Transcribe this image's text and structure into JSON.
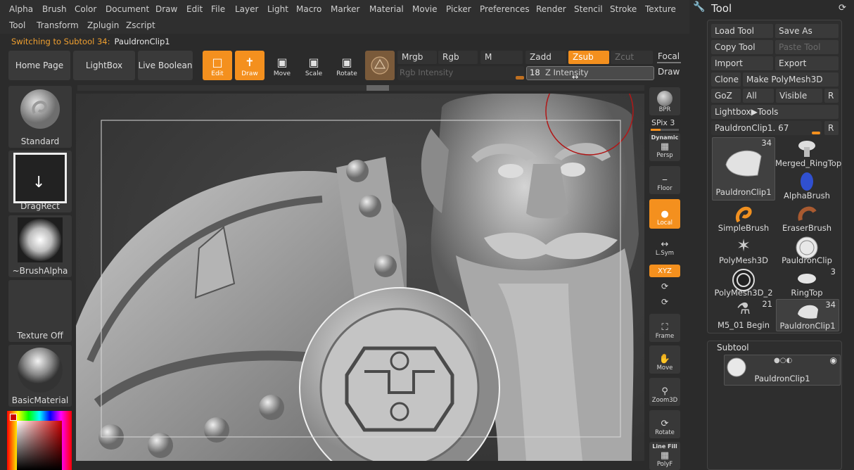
{
  "menu": [
    "Alpha",
    "Brush",
    "Color",
    "Document",
    "Draw",
    "Edit",
    "File",
    "Layer",
    "Light",
    "Macro",
    "Marker",
    "Material",
    "Movie",
    "Picker",
    "Preferences",
    "Render",
    "Stencil",
    "Stroke",
    "Texture",
    "Tool",
    "Transform",
    "Zplugin",
    "Zscript"
  ],
  "status": {
    "key": "Switching to Subtool 34:",
    "value": "PauldronClip1"
  },
  "top_buttons": {
    "home": "Home Page",
    "lightbox": "LightBox",
    "live_boolean": "Live Boolean"
  },
  "tools": {
    "edit": "Edit",
    "draw": "Draw",
    "move": "Move",
    "scale": "Scale",
    "rotate": "Rotate"
  },
  "modes": {
    "mrgb": "Mrgb",
    "rgb": "Rgb",
    "m": "M",
    "zadd": "Zadd",
    "zsub": "Zsub",
    "zcut": "Zcut",
    "focal": "Focal",
    "draw": "Draw",
    "rgb_intensity": "Rgb Intensity",
    "z_intensity_value": "18",
    "z_intensity_label": "Z Intensity"
  },
  "left": {
    "brush": "Standard",
    "stroke": "DragRect",
    "alpha": "~BrushAlpha",
    "texture": "Texture Off",
    "material": "BasicMaterial"
  },
  "rail": {
    "bpr": "BPR",
    "spix": "SPix 3",
    "dynamic": "Dynamic",
    "persp": "Persp",
    "floor": "Floor",
    "local": "Local",
    "lsym": "L.Sym",
    "xyz": "XYZ",
    "frame": "Frame",
    "move": "Move",
    "zoom3d": "Zoom3D",
    "rotate": "Rotate",
    "linefill": "Line Fill",
    "polyf": "PolyF"
  },
  "panel": {
    "title": "Tool",
    "load": "Load Tool",
    "save_as": "Save As",
    "copy": "Copy Tool",
    "paste": "Paste Tool",
    "import": "Import",
    "export": "Export",
    "clone": "Clone",
    "make_polymesh": "Make PolyMesh3D",
    "goz": "GoZ",
    "all": "All",
    "visible": "Visible",
    "r": "R",
    "lightbox_tools": "Lightbox▶Tools",
    "current_tool": "PauldronClip1. 67",
    "r2": "R",
    "tools": [
      {
        "name": "PauldronClip1",
        "count": "34"
      },
      {
        "name": "Merged_RingTop",
        "count": ""
      },
      {
        "name": "AlphaBrush",
        "count": ""
      },
      {
        "name": "SimpleBrush",
        "count": ""
      },
      {
        "name": "EraserBrush",
        "count": ""
      },
      {
        "name": "PolyMesh3D",
        "count": ""
      },
      {
        "name": "PauldronClip",
        "count": ""
      },
      {
        "name": "PolyMesh3D_2",
        "count": ""
      },
      {
        "name": "RingTop",
        "count": "3"
      },
      {
        "name": "M5_01 Begin",
        "count": "21"
      },
      {
        "name": "PauldronClip1",
        "count": "34"
      }
    ],
    "subtool_title": "Subtool",
    "subtool_name": "PauldronClip1"
  },
  "colors": {
    "accent": "#f4901e"
  }
}
